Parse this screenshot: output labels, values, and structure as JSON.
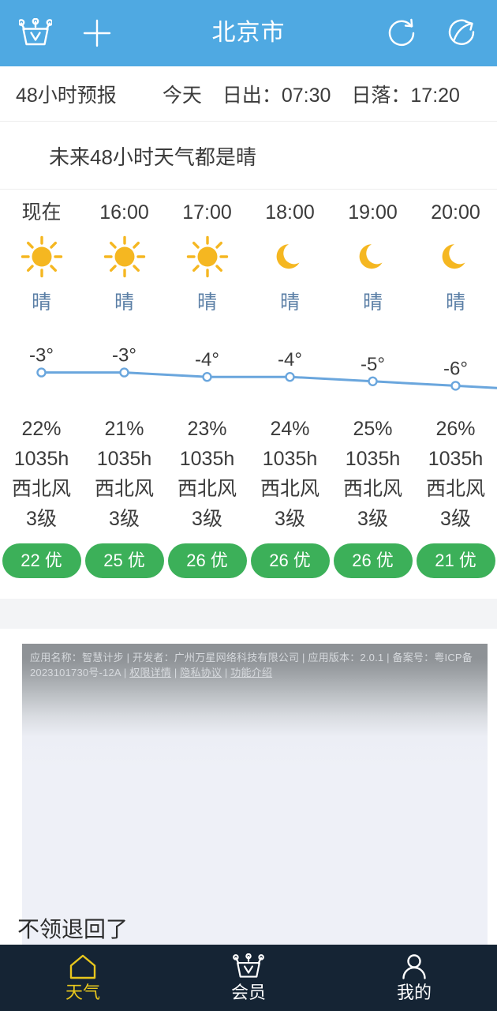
{
  "header": {
    "title": "北京市",
    "bg_color": "#4fa9e2",
    "icons": {
      "vip_crown": "crown-icon",
      "add": "plus-icon",
      "refresh": "refresh-icon",
      "share": "share-icon"
    }
  },
  "subheader": {
    "forecast_label": "48小时预报",
    "day_label": "今天",
    "sunrise": "日出：07:30",
    "sunset": "日落：17:20"
  },
  "summary": {
    "text": "未来48小时天气都是晴"
  },
  "hourly": {
    "columns": [
      {
        "time": "现在",
        "icon": "sun-icon",
        "condition": "晴",
        "temp": "-3°",
        "humidity": "22%",
        "pressure": "1035h",
        "wind_dir": "西北风",
        "wind_level": "3级",
        "aqi": "22 优"
      },
      {
        "time": "16:00",
        "icon": "sun-icon",
        "condition": "晴",
        "temp": "-3°",
        "humidity": "21%",
        "pressure": "1035h",
        "wind_dir": "西北风",
        "wind_level": "3级",
        "aqi": "25 优"
      },
      {
        "time": "17:00",
        "icon": "sun-icon",
        "condition": "晴",
        "temp": "-4°",
        "humidity": "23%",
        "pressure": "1035h",
        "wind_dir": "西北风",
        "wind_level": "3级",
        "aqi": "26 优"
      },
      {
        "time": "18:00",
        "icon": "moon-icon",
        "condition": "晴",
        "temp": "-4°",
        "humidity": "24%",
        "pressure": "1035h",
        "wind_dir": "西北风",
        "wind_level": "3级",
        "aqi": "26 优"
      },
      {
        "time": "19:00",
        "icon": "moon-icon",
        "condition": "晴",
        "temp": "-5°",
        "humidity": "25%",
        "pressure": "1035h",
        "wind_dir": "西北风",
        "wind_level": "3级",
        "aqi": "26 优"
      },
      {
        "time": "20:00",
        "icon": "moon-icon",
        "condition": "晴",
        "temp": "-6°",
        "humidity": "26%",
        "pressure": "1035h",
        "wind_dir": "西北风",
        "wind_level": "3级",
        "aqi": "21 优"
      }
    ]
  },
  "chart_data": {
    "type": "line",
    "title": "",
    "xlabel": "",
    "ylabel": "",
    "x": [
      "现在",
      "16:00",
      "17:00",
      "18:00",
      "19:00",
      "20:00"
    ],
    "categories": [
      "现在",
      "16:00",
      "17:00",
      "18:00",
      "19:00",
      "20:00"
    ],
    "values": [
      -3,
      -3,
      -4,
      -4,
      -5,
      -6
    ],
    "point_labels": [
      "-3°",
      "-3°",
      "-4°",
      "-4°",
      "-5°",
      "-6°"
    ],
    "line_color": "#6aa6dd",
    "marker_fill": "#ffffff",
    "grid": false,
    "legend": "none",
    "ylim": [
      -7,
      -2
    ]
  },
  "colors": {
    "header_blue": "#4fa9e2",
    "sun_yellow": "#f5b721",
    "moon_yellow": "#f5b721",
    "condition_blue": "#5b7fa6",
    "aqi_green": "#3cb059",
    "chart_line": "#6aa6dd",
    "nav_dark": "#152434",
    "nav_active": "#e8c71d"
  },
  "ad": {
    "fineprint_line1": "应用名称：智慧计步 | 开发者：广州万星网络科技有限公司 | 应用版本：2.0.1 | 备案号：粤ICP备",
    "fineprint_line2_prefix": "2023101730号-12A | ",
    "link_permissions": "权限详情",
    "sep1": " | ",
    "link_privacy": "隐私协议",
    "sep2": " | ",
    "link_features": "功能介绍"
  },
  "bottom": {
    "text": "不领退回了"
  },
  "navbar": {
    "items": [
      {
        "label": "天气",
        "icon": "home-icon",
        "active": true
      },
      {
        "label": "会员",
        "icon": "crown-icon",
        "active": false
      },
      {
        "label": "我的",
        "icon": "person-icon",
        "active": false
      }
    ]
  }
}
